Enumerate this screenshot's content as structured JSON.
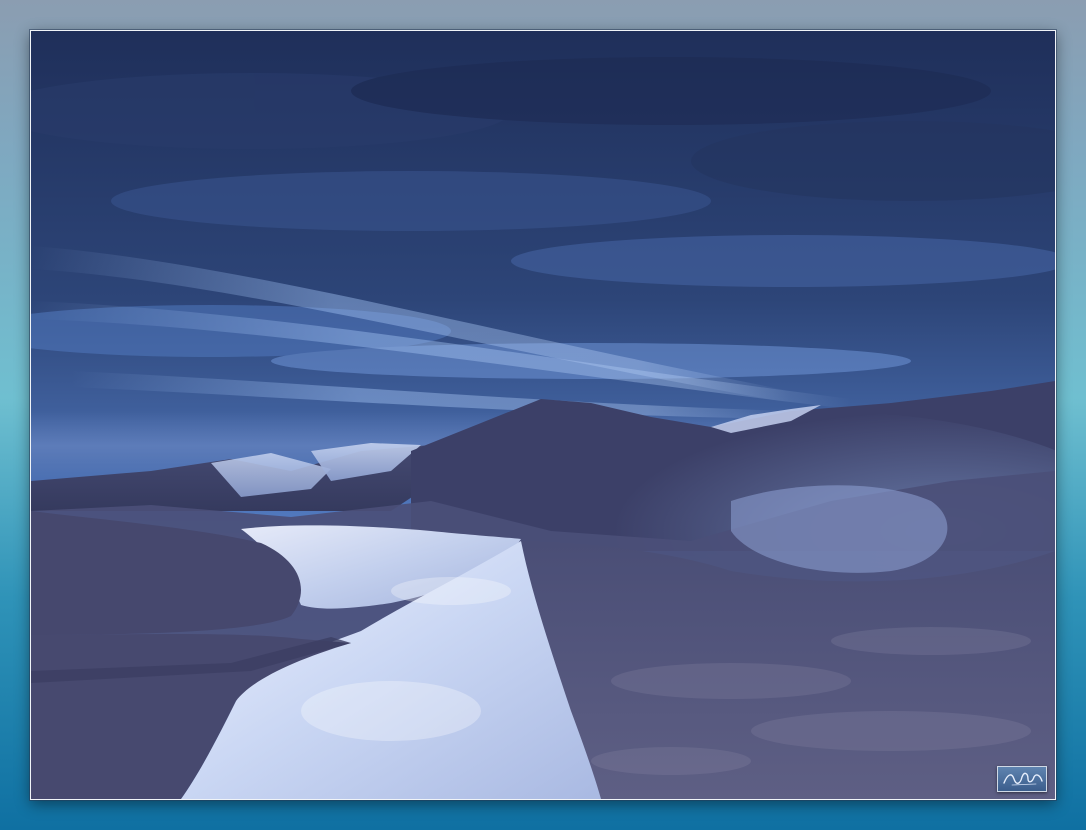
{
  "artwork": {
    "subject": "snowy-hills-under-cloudy-sky",
    "colors": {
      "border_top": "#8b9db1",
      "border_mid": "#6fbfd0",
      "border_bottom": "#0f70a2",
      "sky_dark": "#1f2f5a",
      "sky_light": "#6d95d8",
      "snow": "#dfe6fa",
      "hill_dark": "#3a3f62",
      "hill_mid": "#5c5e86"
    }
  },
  "signature_badge": {
    "icon": "signature-icon"
  }
}
